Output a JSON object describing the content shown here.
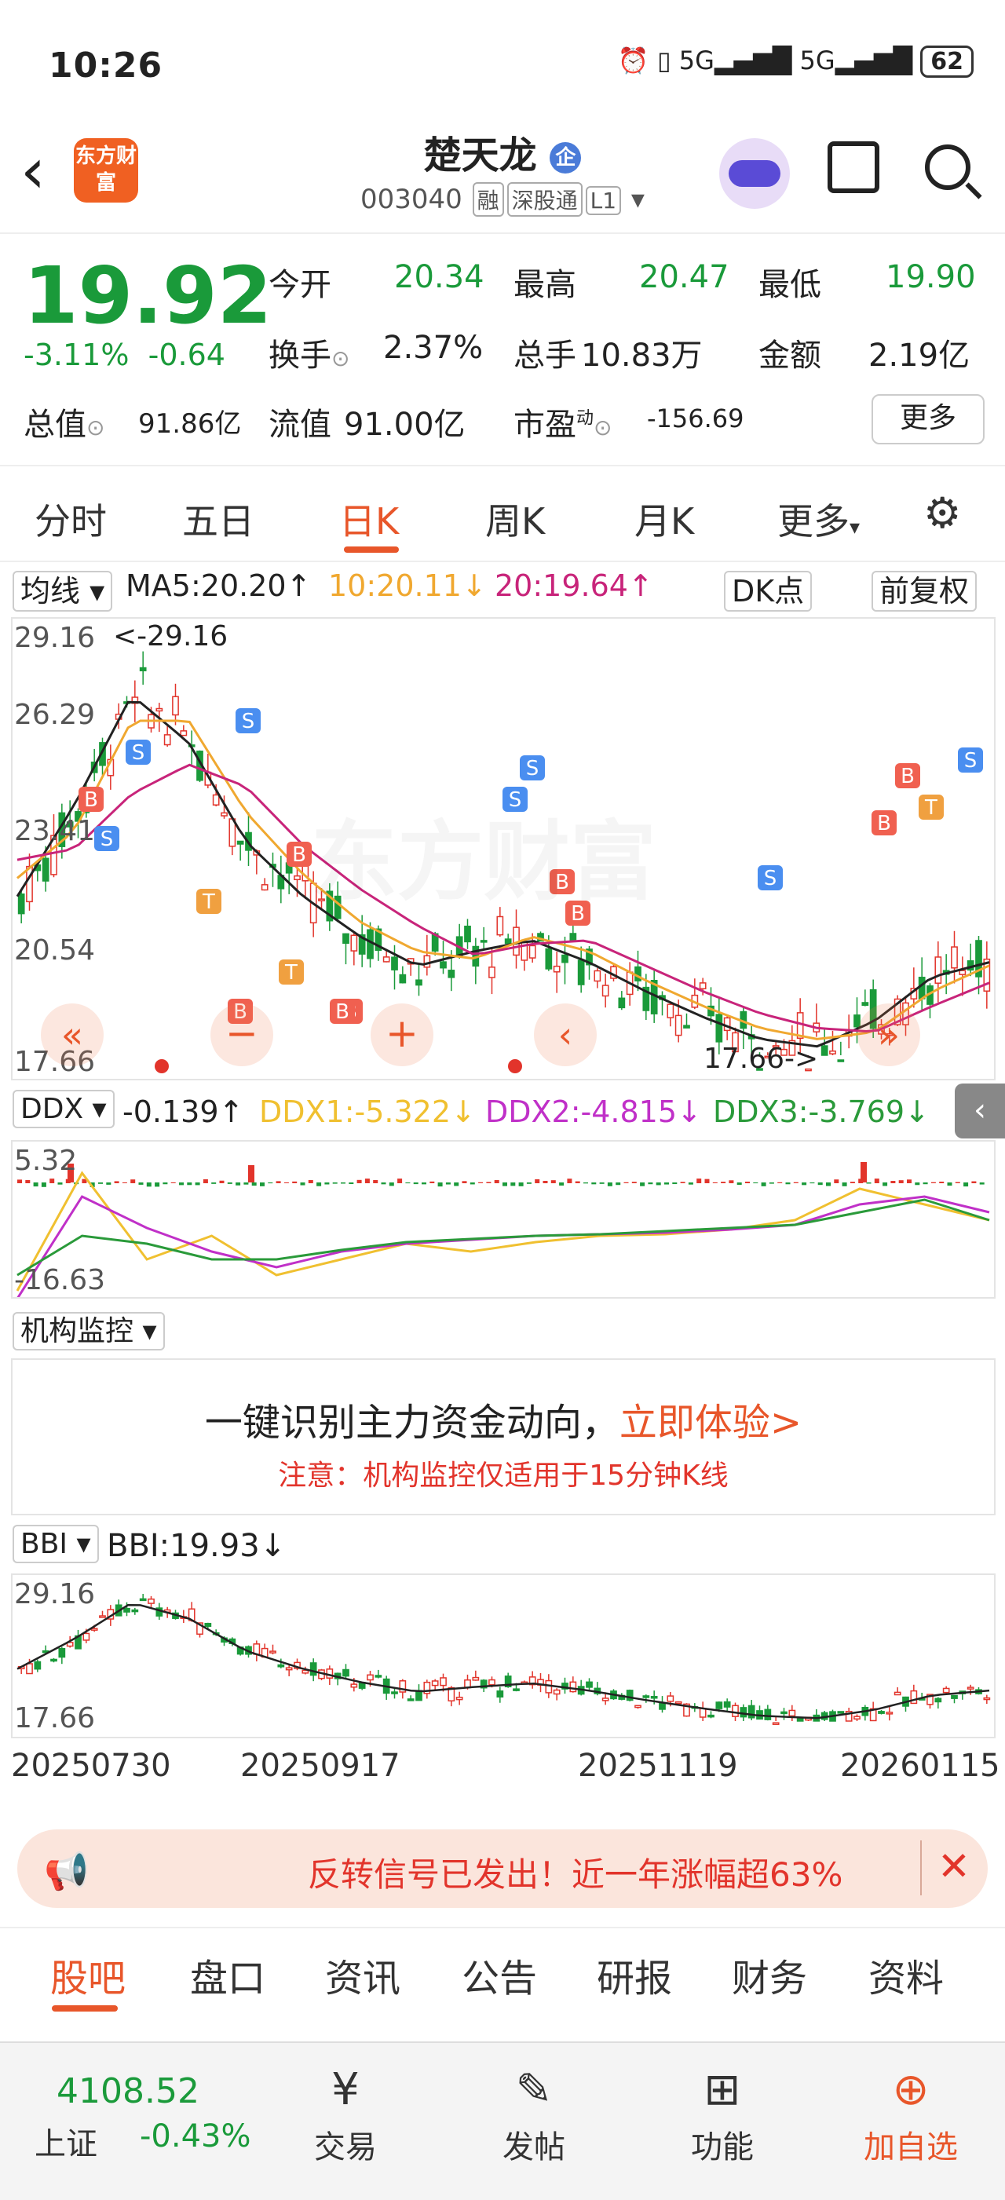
{
  "status_bar": {
    "time": "10:26",
    "network1": "5G",
    "network2": "5G",
    "battery": "62"
  },
  "header": {
    "logo_text": "东方财富",
    "title": "楚天龙",
    "badge": "企",
    "code": "003040",
    "tags": [
      "融",
      "深股通",
      "L1"
    ]
  },
  "quote": {
    "price": "19.92",
    "change_pct": "-3.11%",
    "change": "-0.64",
    "open_label": "今开",
    "open": "20.34",
    "high_label": "最高",
    "high": "20.47",
    "low_label": "最低",
    "low": "19.90",
    "turnover_label": "换手",
    "turnover": "2.37%",
    "volume_label": "总手",
    "volume": "10.83万",
    "amount_label": "金额",
    "amount": "2.19亿",
    "mktcap_label": "总值",
    "mktcap": "91.86亿",
    "float_label": "流值",
    "float": "91.00亿",
    "pe_label": "市盈",
    "pe_sup": "动",
    "pe": "-156.69",
    "more": "更多"
  },
  "period_tabs": [
    "分时",
    "五日",
    "日K",
    "周K",
    "月K",
    "更多"
  ],
  "active_period": "日K",
  "kline": {
    "ma_label": "均线",
    "ma5": "MA5:20.20↑",
    "ma10": "10:20.11↓",
    "ma20": "20:19.64↑",
    "dk": "DK点",
    "fq": "前复权",
    "ymax": "29.16",
    "y2": "26.29",
    "y3": "23.41",
    "y4": "20.54",
    "ymin": "17.66",
    "max_marker": "<-29.16",
    "min_marker": "17.66->",
    "watermark": "东方财富"
  },
  "ddx": {
    "label": "DDX",
    "value": "-0.139↑",
    "ddx1": "DDX1:-5.322↓",
    "ddx2": "DDX2:-4.815↓",
    "ddx3": "DDX3:-3.769↓",
    "ymax": "5.32",
    "ymin": "-16.63"
  },
  "jigou": {
    "label": "机构监控",
    "headline": "一键识别主力资金动向，",
    "cta": "立即体验>",
    "note": "注意：机构监控仅适用于15分钟K线"
  },
  "bbi": {
    "label": "BBI",
    "value": "BBI:19.93↓",
    "ymax": "29.16",
    "ymin": "17.66",
    "dates": [
      "20250730",
      "20250917",
      "20251119",
      "20260115"
    ]
  },
  "banner": {
    "text": "反转信号已发出！近一年涨幅超63%"
  },
  "bottom_tabs": [
    "股吧",
    "盘口",
    "资讯",
    "公告",
    "研报",
    "财务",
    "资料"
  ],
  "index": {
    "value": "4108.52",
    "name": "上证",
    "change": "-0.43%"
  },
  "nav": [
    {
      "label": "交易",
      "icon": "yen-icon"
    },
    {
      "label": "发帖",
      "icon": "edit-icon"
    },
    {
      "label": "功能",
      "icon": "grid-icon"
    },
    {
      "label": "加自选",
      "icon": "add-icon"
    }
  ],
  "colors": {
    "up": "#e2342b",
    "down": "#1a9a3a",
    "accent": "#e8562a",
    "ma5": "#222222",
    "ma10": "#f0a830",
    "ma20": "#c8247a"
  },
  "chart_data": {
    "type": "line",
    "title": "",
    "x_labels": [
      "20250730",
      "20250917",
      "20251119",
      "20260115"
    ],
    "ylim": [
      17.66,
      29.16
    ],
    "series": [
      {
        "name": "MA5",
        "values": [
          22.0,
          24.5,
          27.5,
          26.2,
          23.5,
          22.0,
          20.9,
          20.1,
          20.5,
          20.8,
          20.2,
          19.4,
          18.7,
          18.1,
          17.9,
          18.6,
          19.8,
          20.2
        ]
      },
      {
        "name": "10",
        "values": [
          22.5,
          23.8,
          26.8,
          26.8,
          24.3,
          22.6,
          21.3,
          20.5,
          20.3,
          20.9,
          20.5,
          19.7,
          19.0,
          18.4,
          18.1,
          18.3,
          19.4,
          20.11
        ]
      },
      {
        "name": "20",
        "values": [
          23.0,
          23.3,
          24.8,
          25.6,
          25.0,
          23.4,
          22.2,
          21.2,
          20.4,
          20.7,
          20.8,
          20.1,
          19.4,
          18.8,
          18.4,
          18.3,
          19.0,
          19.64
        ]
      }
    ]
  }
}
